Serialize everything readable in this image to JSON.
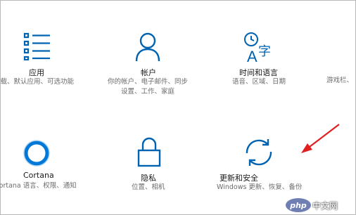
{
  "settings": {
    "tiles": [
      {
        "title": "应用",
        "desc_lines": [
          "卸载、默认应用、可选功能"
        ]
      },
      {
        "title": "帐户",
        "desc_lines": [
          "你的帐户、电子邮件、同步",
          "设置、工作、家庭"
        ]
      },
      {
        "title": "时间和语言",
        "desc_lines": [
          "语音、区域、日期"
        ]
      },
      {
        "title": "",
        "desc_lines": [
          "游戏栏、"
        ]
      },
      {
        "title": "Cortana",
        "desc_lines": [
          "Cortana 语言、权限、通知"
        ]
      },
      {
        "title": "隐私",
        "desc_lines": [
          "位置、相机"
        ]
      },
      {
        "title": "更新和安全",
        "desc_lines": [
          "Windows 更新、恢复、备份"
        ]
      }
    ]
  },
  "watermark": {
    "logo": "php",
    "text": "中文网"
  },
  "colors": {
    "accent": "#0063b1",
    "arrow": "#e02020"
  }
}
